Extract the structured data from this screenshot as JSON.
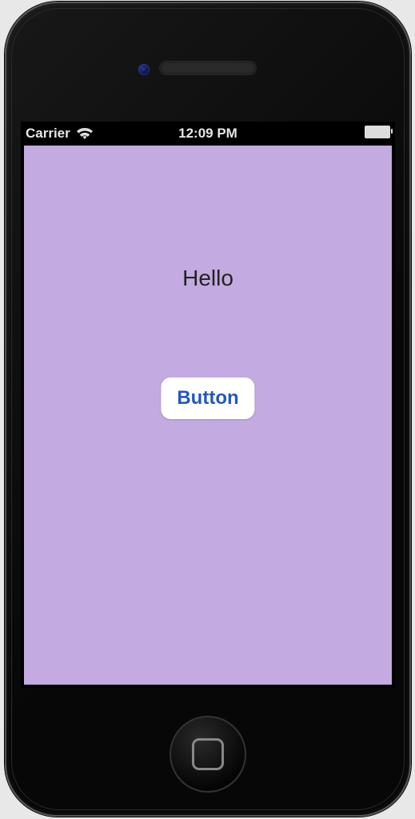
{
  "status": {
    "carrier": "Carrier",
    "time": "12:09 PM"
  },
  "app": {
    "greeting_text": "Hello",
    "button_label": "Button"
  }
}
